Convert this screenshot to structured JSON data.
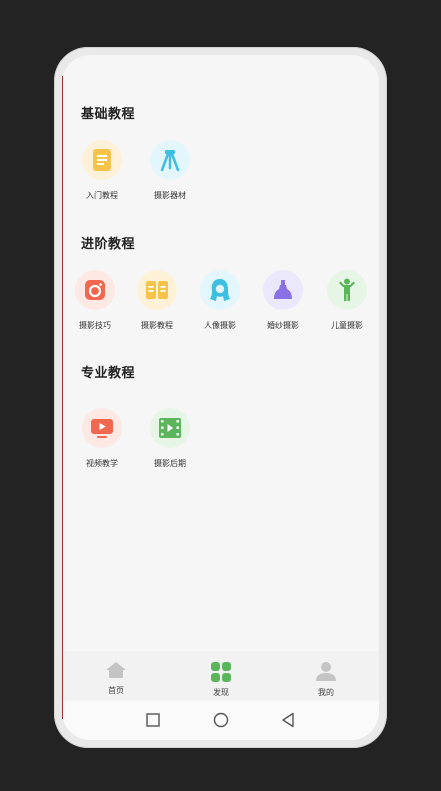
{
  "sections": [
    {
      "title": "基础教程",
      "items": [
        {
          "label": "入门教程",
          "icon": "document-icon"
        },
        {
          "label": "摄影器材",
          "icon": "tripod-icon"
        }
      ]
    },
    {
      "title": "进阶教程",
      "items": [
        {
          "label": "摄影技巧",
          "icon": "camera-icon"
        },
        {
          "label": "摄影教程",
          "icon": "book-icon"
        },
        {
          "label": "人像摄影",
          "icon": "portrait-icon"
        },
        {
          "label": "婚纱摄影",
          "icon": "wedding-dress-icon"
        },
        {
          "label": "儿童摄影",
          "icon": "child-icon"
        }
      ]
    },
    {
      "title": "专业教程",
      "items": [
        {
          "label": "视频教学",
          "icon": "video-play-icon"
        },
        {
          "label": "摄影后期",
          "icon": "film-icon"
        }
      ]
    }
  ],
  "tabbar": {
    "tabs": [
      {
        "label": "首页",
        "icon": "home-icon",
        "active": false
      },
      {
        "label": "发现",
        "icon": "grid-icon",
        "active": true
      },
      {
        "label": "我的",
        "icon": "user-icon",
        "active": false
      }
    ]
  },
  "navbar": {
    "buttons": [
      "recents-icon",
      "home-circle-icon",
      "back-icon"
    ]
  },
  "colors": {
    "accent_green": "#5bb65b",
    "inactive_gray": "#c4c4c4",
    "background": "#f6f6f6"
  }
}
